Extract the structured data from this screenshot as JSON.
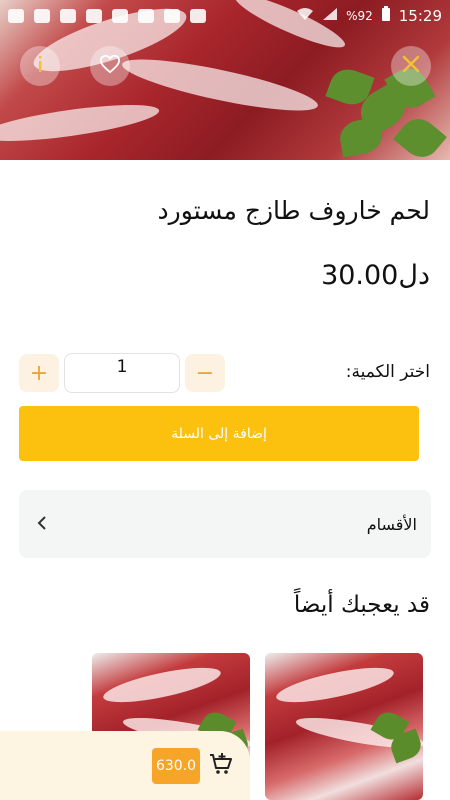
{
  "status_bar": {
    "time": "15:29",
    "battery": "%92"
  },
  "product": {
    "title": "لحم خاروف طازج مستورد",
    "price": "دل30.00"
  },
  "quantity": {
    "label": "اختر الكمية:",
    "value": "1",
    "plus": "+",
    "minus": "−"
  },
  "add_to_cart_label": "إضافة إلى السلة",
  "categories_label": "الأقسام",
  "you_may_like_title": "قد يعجبك أيضاً",
  "cart": {
    "total": "630.0"
  },
  "colors": {
    "accent": "#fcc00f",
    "cart_badge": "#f7a529",
    "stepper_bg": "#fdf2e1"
  },
  "icons": [
    "close-icon",
    "heart-icon",
    "info-icon",
    "chevron-left-icon",
    "cart-add-icon"
  ]
}
